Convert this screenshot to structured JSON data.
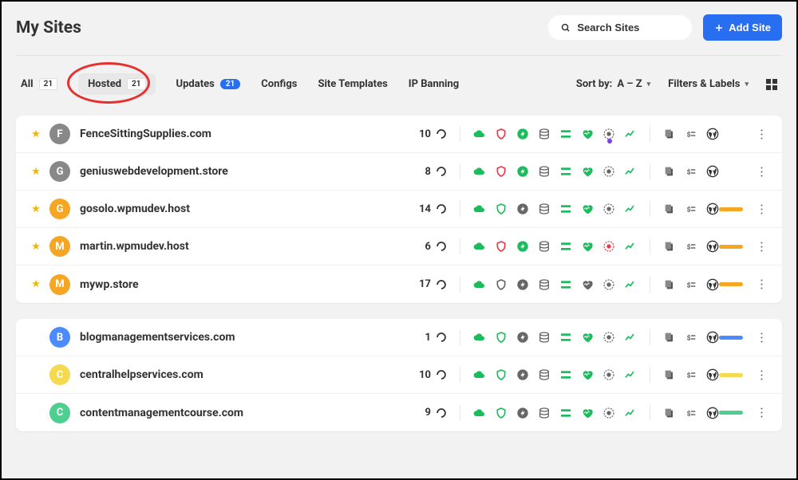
{
  "header": {
    "title": "My Sites",
    "search_placeholder": "Search Sites",
    "add_site_label": "Add Site"
  },
  "tabs": {
    "all": {
      "label": "All",
      "count": "21"
    },
    "hosted": {
      "label": "Hosted",
      "count": "21"
    },
    "updates": {
      "label": "Updates",
      "count": "21"
    },
    "configs": {
      "label": "Configs"
    },
    "site_templates": {
      "label": "Site Templates"
    },
    "ip_banning": {
      "label": "IP Banning"
    }
  },
  "sort": {
    "label": "Sort by:",
    "value": "A – Z"
  },
  "filters_label": "Filters & Labels",
  "icon_colors": {
    "green": "#1abc5b",
    "red": "#e63946",
    "grey": "#666"
  },
  "sites_group1": [
    {
      "star": true,
      "letter": "F",
      "avatar_class": "c-grey",
      "name": "FenceSittingSupplies.com",
      "updates": "10",
      "shield": "red",
      "bolt": "green",
      "db": "grey",
      "heart": "green",
      "bug": "grey",
      "dot": true,
      "tag": ""
    },
    {
      "star": true,
      "letter": "G",
      "avatar_class": "c-grey",
      "name": "geniuswebdevelopment.store",
      "updates": "8",
      "shield": "red",
      "bolt": "green",
      "db": "grey",
      "heart": "green",
      "bug": "grey",
      "dot": false,
      "tag": ""
    },
    {
      "star": true,
      "letter": "G",
      "avatar_class": "c-orange",
      "name": "gosolo.wpmudev.host",
      "updates": "14",
      "shield": "green",
      "bolt": "grey",
      "db": "grey",
      "heart": "green",
      "bug": "grey",
      "dot": false,
      "tag": "t-orange"
    },
    {
      "star": true,
      "letter": "M",
      "avatar_class": "c-orange",
      "name": "martin.wpmudev.host",
      "updates": "6",
      "shield": "red",
      "bolt": "green",
      "db": "grey",
      "heart": "green",
      "bug": "red",
      "dot": false,
      "tag": "t-orange"
    },
    {
      "star": true,
      "letter": "M",
      "avatar_class": "c-orange",
      "name": "mywp.store",
      "updates": "17",
      "shield": "grey",
      "bolt": "grey",
      "db": "grey",
      "heart": "grey",
      "bug": "grey",
      "dot": false,
      "tag": "t-orange"
    }
  ],
  "sites_group2": [
    {
      "star": false,
      "letter": "B",
      "avatar_class": "c-blue",
      "name": "blogmanagementservices.com",
      "updates": "1",
      "shield": "green",
      "bolt": "grey",
      "db": "grey",
      "heart": "green",
      "bug": "grey",
      "dot": false,
      "tag": "t-blue"
    },
    {
      "star": false,
      "letter": "C",
      "avatar_class": "c-yellow",
      "name": "centralhelpservices.com",
      "updates": "10",
      "shield": "green",
      "bolt": "grey",
      "db": "grey",
      "heart": "green",
      "bug": "grey",
      "dot": false,
      "tag": "t-yellow"
    },
    {
      "star": false,
      "letter": "C",
      "avatar_class": "c-green",
      "name": "contentmanagementcourse.com",
      "updates": "9",
      "shield": "green",
      "bolt": "grey",
      "db": "grey",
      "heart": "green",
      "bug": "grey",
      "dot": false,
      "tag": "t-green"
    }
  ]
}
